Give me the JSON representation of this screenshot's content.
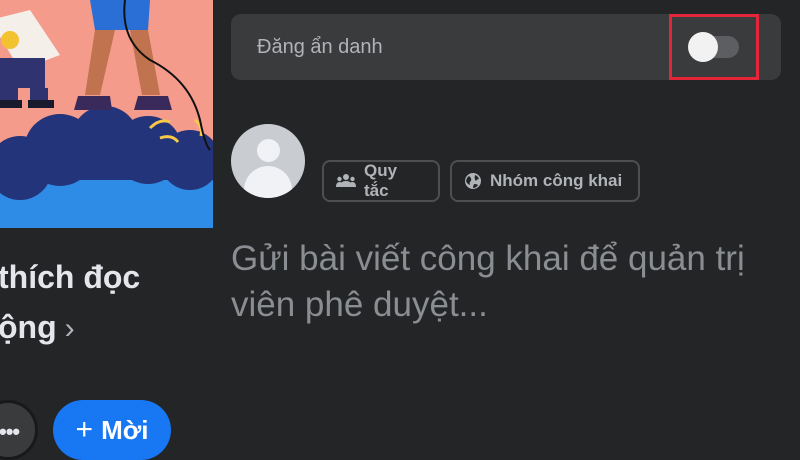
{
  "group": {
    "name_line1": "thích đọc",
    "name_line2": "ộng",
    "chevron_icon": "chevron-right-icon",
    "invite_label": "Mời",
    "invite_icon": "plus-icon",
    "more_icon": "more-dots-icon"
  },
  "composer": {
    "anonymous_label": "Đăng ẩn danh",
    "anonymous_enabled": false,
    "placeholder": "Gửi bài viết công khai để quản trị viên phê duyệt..."
  },
  "chips": [
    {
      "label": "Quy tắc",
      "icon": "people-icon"
    },
    {
      "label": "Nhóm công khai",
      "icon": "globe-icon"
    }
  ],
  "colors": {
    "background": "#242526",
    "surface": "#3a3b3c",
    "accent": "#1877f2",
    "highlight": "#e5263a"
  }
}
